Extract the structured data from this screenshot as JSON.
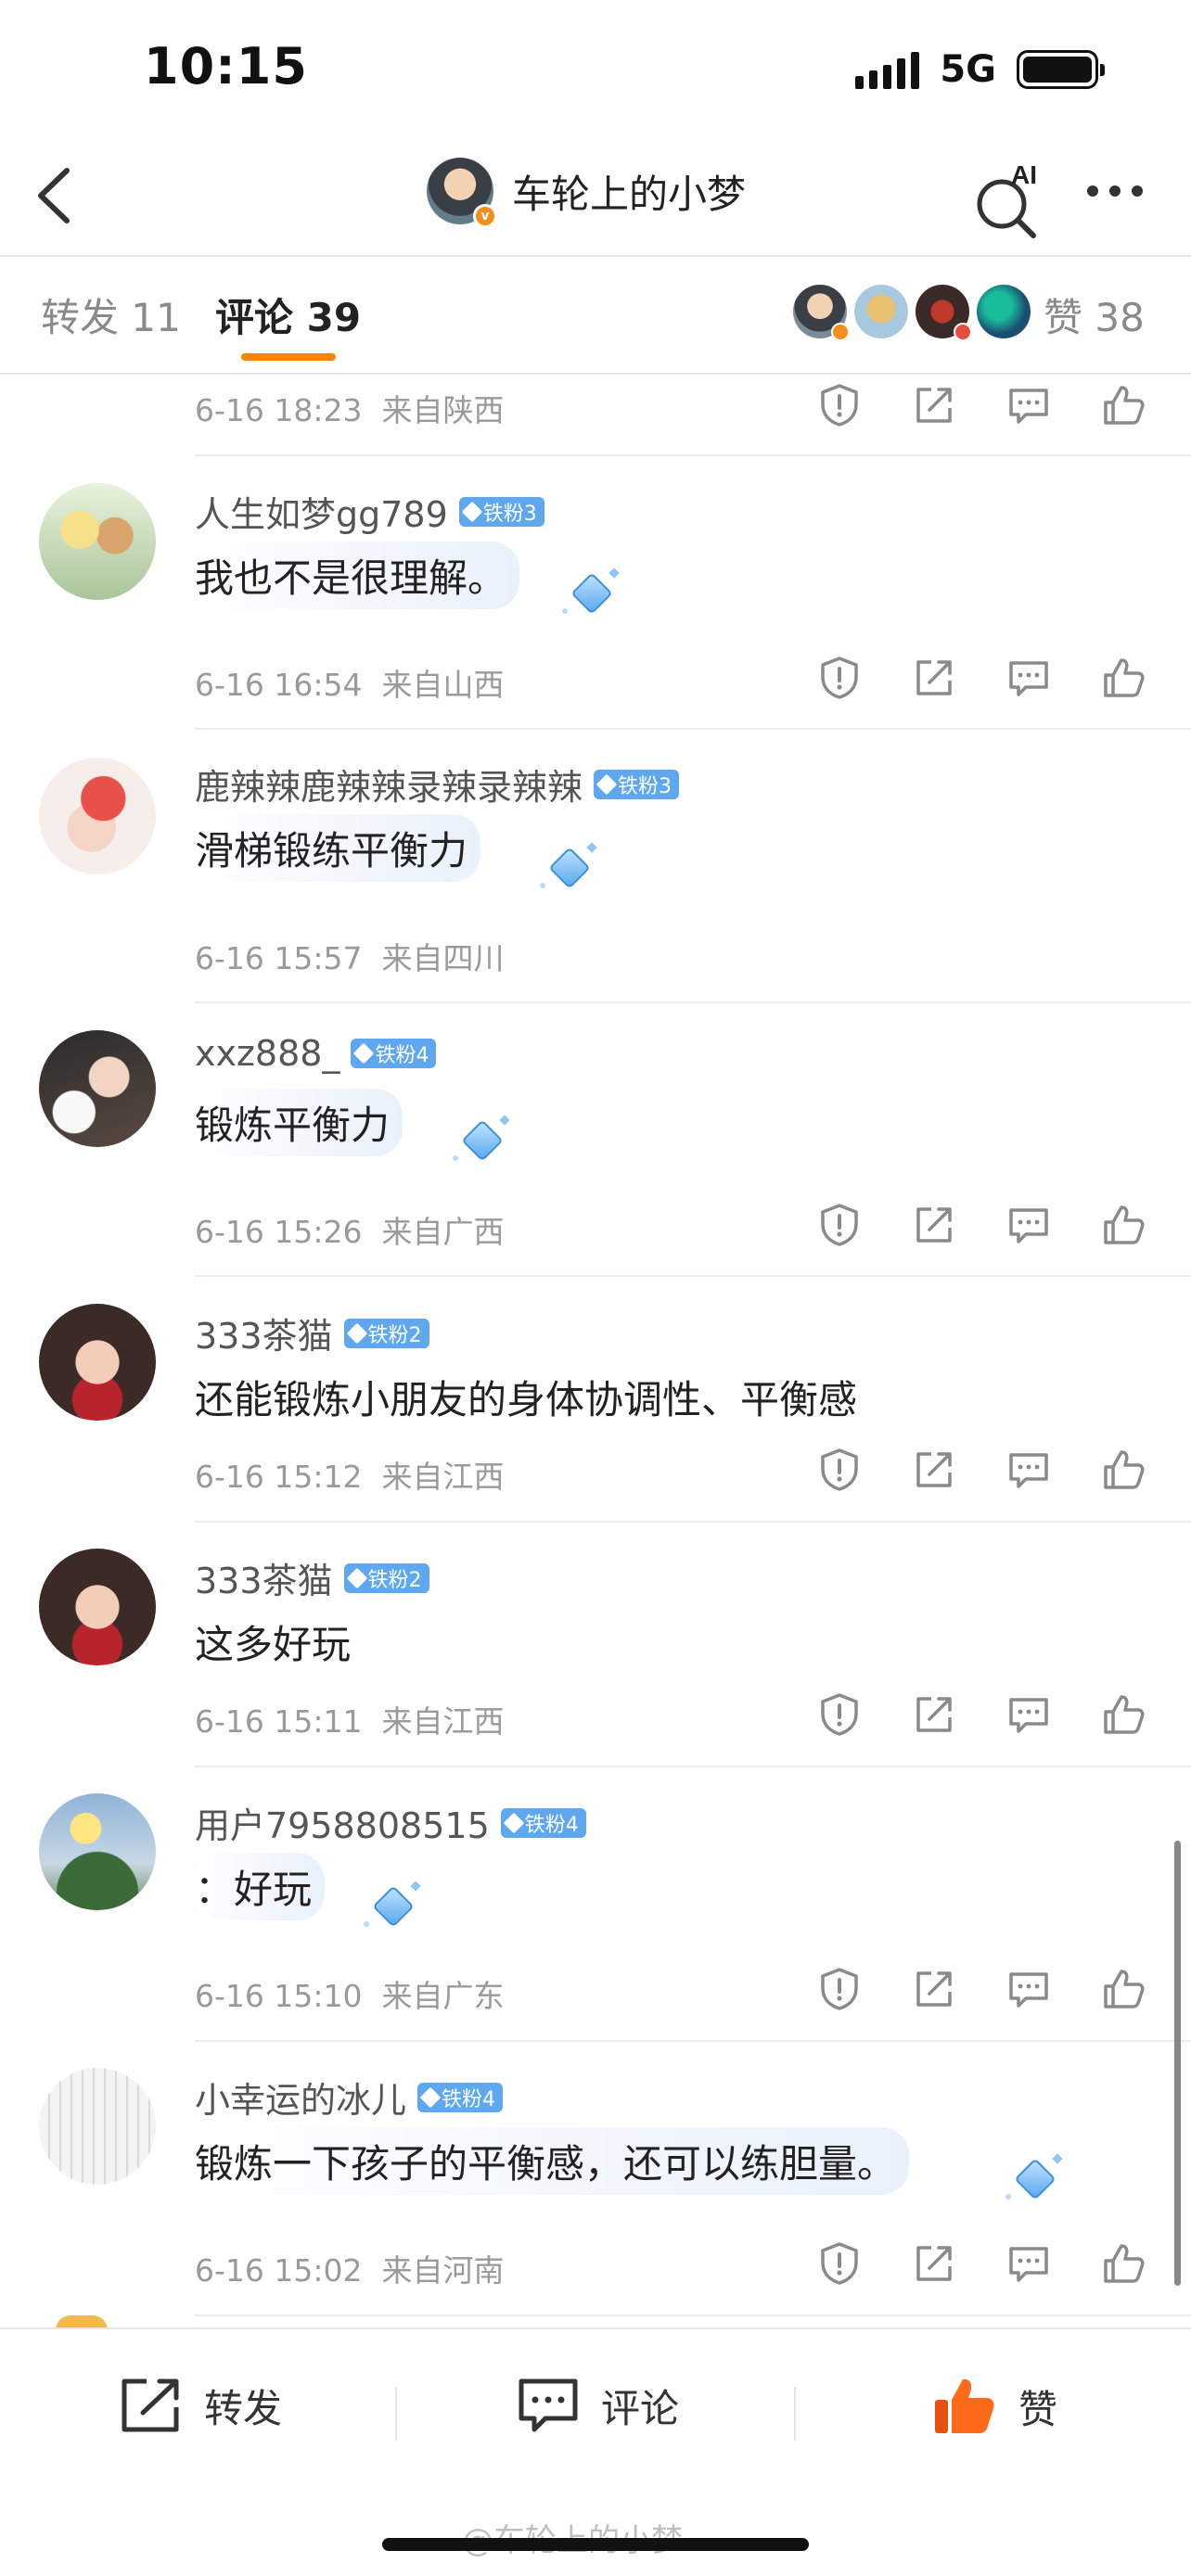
{
  "status_bar": {
    "time": "10:15",
    "network": "5G"
  },
  "nav": {
    "title": "车轮上的小梦",
    "ai_label": "AI"
  },
  "tabs": {
    "repost": "转发 11",
    "comments": "评论 39",
    "likes": "赞 38"
  },
  "top_meta": {
    "time": "6-16 18:23",
    "location": "来自陕西"
  },
  "comments": [
    {
      "username": "人生如梦gg789",
      "badge": "铁粉3",
      "text": "我也不是很理解。",
      "time": "6-16 16:54",
      "location": "来自山西"
    },
    {
      "username": "鹿辣辣鹿辣辣录辣录辣辣",
      "badge": "铁粉3",
      "text": "滑梯锻练平衡力",
      "time": "6-16 15:57",
      "location": "来自四川"
    },
    {
      "username": "xxz888_",
      "badge": "铁粉4",
      "text": "锻炼平衡力",
      "time": "6-16 15:26",
      "location": "来自广西"
    },
    {
      "username": "333茶猫",
      "badge": "铁粉2",
      "text": "还能锻炼小朋友的身体协调性、平衡感",
      "time": "6-16 15:12",
      "location": "来自江西"
    },
    {
      "username": "333茶猫",
      "badge": "铁粉2",
      "text": "这多好玩",
      "time": "6-16 15:11",
      "location": "来自江西"
    },
    {
      "username": "用户7958808515",
      "badge": "铁粉4",
      "text": "：好玩",
      "time": "6-16 15:10",
      "location": "来自广东"
    },
    {
      "username": "小幸运的冰儿",
      "badge": "铁粉4",
      "text": "锻炼一下孩子的平衡感，还可以练胆量。",
      "time": "6-16 15:02",
      "location": "来自河南"
    }
  ],
  "bottom_bar": {
    "repost": "转发",
    "comment": "评论",
    "like": "赞"
  },
  "watermark": "@车轮上的小梦",
  "colors": {
    "accent": "#ff8200",
    "badge_blue": "#5fa8f0",
    "like_orange": "#ff6a1a"
  }
}
